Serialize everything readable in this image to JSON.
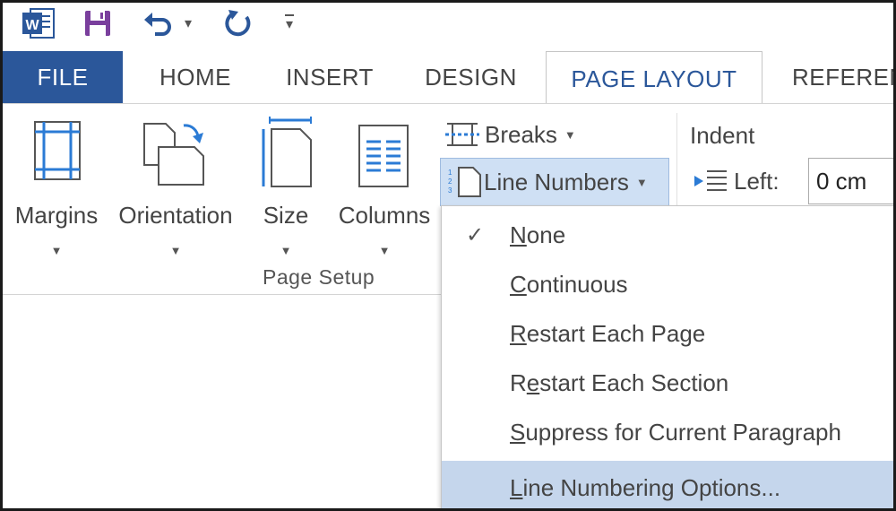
{
  "quick_access": {
    "word_icon": "word-app-icon",
    "save_icon": "save-icon",
    "undo_icon": "undo-icon",
    "undo_dropdown_glyph": "▾",
    "redo_icon": "redo-icon",
    "customize_glyph": "▾"
  },
  "tabs": [
    {
      "label": "FILE"
    },
    {
      "label": "HOME"
    },
    {
      "label": "INSERT"
    },
    {
      "label": "DESIGN"
    },
    {
      "label": "PAGE LAYOUT"
    },
    {
      "label": "REFERENC"
    }
  ],
  "page_setup": {
    "margins": "Margins",
    "orientation": "Orientation",
    "size": "Size",
    "columns": "Columns",
    "group_label": "Page Setup",
    "breaks": "Breaks",
    "line_numbers": "Line Numbers"
  },
  "paragraph": {
    "indent_label": "Indent",
    "left_label": "Left:",
    "left_value": "0 cm"
  },
  "line_numbers_menu": {
    "items": [
      {
        "prefix": "",
        "key": "N",
        "rest": "one",
        "checked": true
      },
      {
        "prefix": "",
        "key": "C",
        "rest": "ontinuous",
        "checked": false
      },
      {
        "prefix": "",
        "key": "R",
        "rest": "estart Each Page",
        "checked": false
      },
      {
        "prefix": "R",
        "key": "e",
        "rest": "start Each Section",
        "checked": false
      },
      {
        "prefix": "",
        "key": "S",
        "rest": "uppress for Current Paragraph",
        "checked": false
      },
      {
        "prefix": "",
        "key": "L",
        "rest": "ine Numbering Options...",
        "checked": false,
        "highlighted": true
      }
    ],
    "check_glyph": "✓"
  },
  "colors": {
    "file_tab": "#2b579a",
    "active_tab_text": "#2b579a",
    "menu_highlight": "#c5d6ec",
    "button_highlight": "#cfe0f4"
  }
}
